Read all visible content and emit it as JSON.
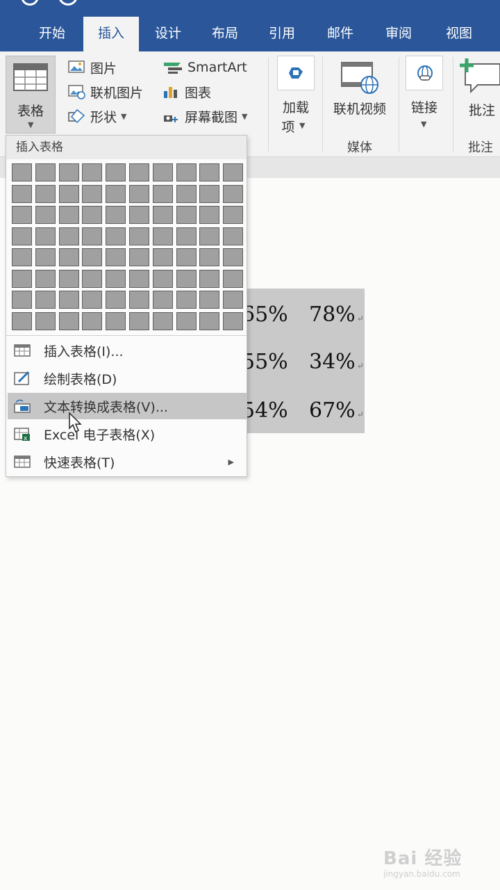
{
  "ribbon_tabs": [
    "开始",
    "插入",
    "设计",
    "布局",
    "引用",
    "邮件",
    "审阅",
    "视图"
  ],
  "active_tab": "插入",
  "ribbon": {
    "table_label": "表格",
    "picture_label": "图片",
    "online_picture_label": "联机图片",
    "shapes_label": "形状",
    "smartart_label": "SmartArt",
    "chart_label": "图表",
    "screenshot_label": "屏幕截图",
    "addins_label_line1": "加载",
    "addins_label_line2": "项",
    "online_video_label": "联机视频",
    "media_group_label": "媒体",
    "link_label": "链接",
    "comment_label": "批注",
    "comment_group_label": "批注"
  },
  "dropdown": {
    "header": "插入表格",
    "grid_cols": 10,
    "grid_rows": 8,
    "items": [
      {
        "label": "插入表格(I)...",
        "icon": "table-icon"
      },
      {
        "label": "绘制表格(D)",
        "icon": "draw-table-icon"
      },
      {
        "label": "文本转换成表格(V)...",
        "icon": "convert-text-table-icon",
        "highlighted": true
      },
      {
        "label": "Excel 电子表格(X)",
        "icon": "excel-table-icon"
      },
      {
        "label": "快速表格(T)",
        "icon": "quick-table-icon",
        "submenu": true
      }
    ]
  },
  "document": {
    "rows": [
      [
        "65%",
        "78%"
      ],
      [
        "55%",
        "34%"
      ],
      [
        "54%",
        "67%"
      ]
    ],
    "pilcrow": "↵"
  },
  "watermark": {
    "main": "Bai 经验",
    "sub": "jingyan.baidu.com"
  }
}
